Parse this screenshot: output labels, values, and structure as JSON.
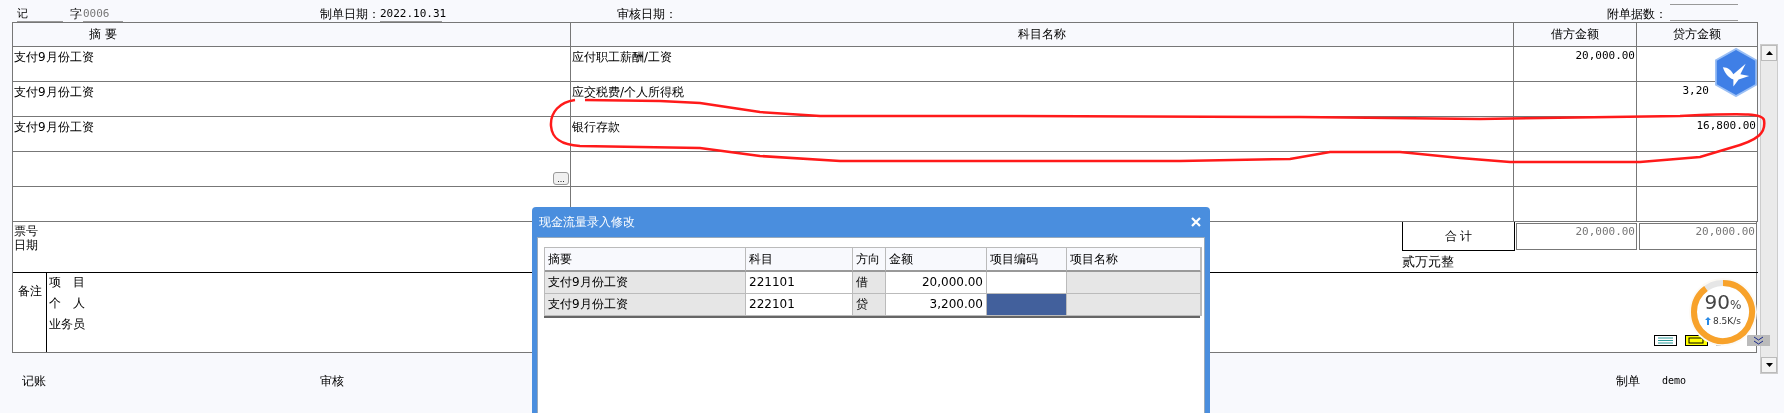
{
  "voucher": {
    "type_label": "记",
    "number_label": "字",
    "number": "0006",
    "date_label": "制单日期：",
    "date": "2022.10.31",
    "review_date_label": "审核日期：",
    "attachments_label": "附单据数："
  },
  "entries": {
    "columns": [
      "摘 要",
      "科目名称",
      "借方金额",
      "贷方金额"
    ],
    "rows": [
      {
        "summary": "支付9月份工资",
        "account": "应付职工薪酬/工资",
        "debit": "20,000.00"
      },
      {
        "summary": "支付9月份工资",
        "account": "应交税费/个人所得税",
        "credit": "3,20"
      },
      {
        "summary": "支付9月份工资",
        "account": "银行存款",
        "credit": "16,800.00"
      }
    ],
    "more_button": "..."
  },
  "ticket": {
    "labels": [
      "票号",
      "日期"
    ]
  },
  "totals": {
    "label": "合 计",
    "debit": "20,000.00",
    "credit": "20,000.00",
    "amount_in_words": "贰万元整"
  },
  "remarks": {
    "label": "备注",
    "items": [
      "项　目",
      "个　人",
      "业务员"
    ]
  },
  "signatures": [
    {
      "label": "记账"
    },
    {
      "label": "审核"
    },
    {
      "label": "制单",
      "value": "demo"
    }
  ],
  "dialog": {
    "title": "现金流量录入修改",
    "columns": [
      "摘要",
      "科目",
      "方向",
      "金额",
      "项目编码",
      "项目名称"
    ],
    "rows": [
      {
        "summary": "支付9月份工资",
        "account": "221101",
        "direction": "借",
        "amount": "20,000.00",
        "code_selected": false
      },
      {
        "summary": "支付9月份工资",
        "account": "222101",
        "direction": "贷",
        "amount": "3,200.00",
        "code_selected": true
      }
    ]
  },
  "speed_meter": {
    "percent": "90",
    "unit": "%",
    "rate": "8.5K/s",
    "level": 0.9
  }
}
